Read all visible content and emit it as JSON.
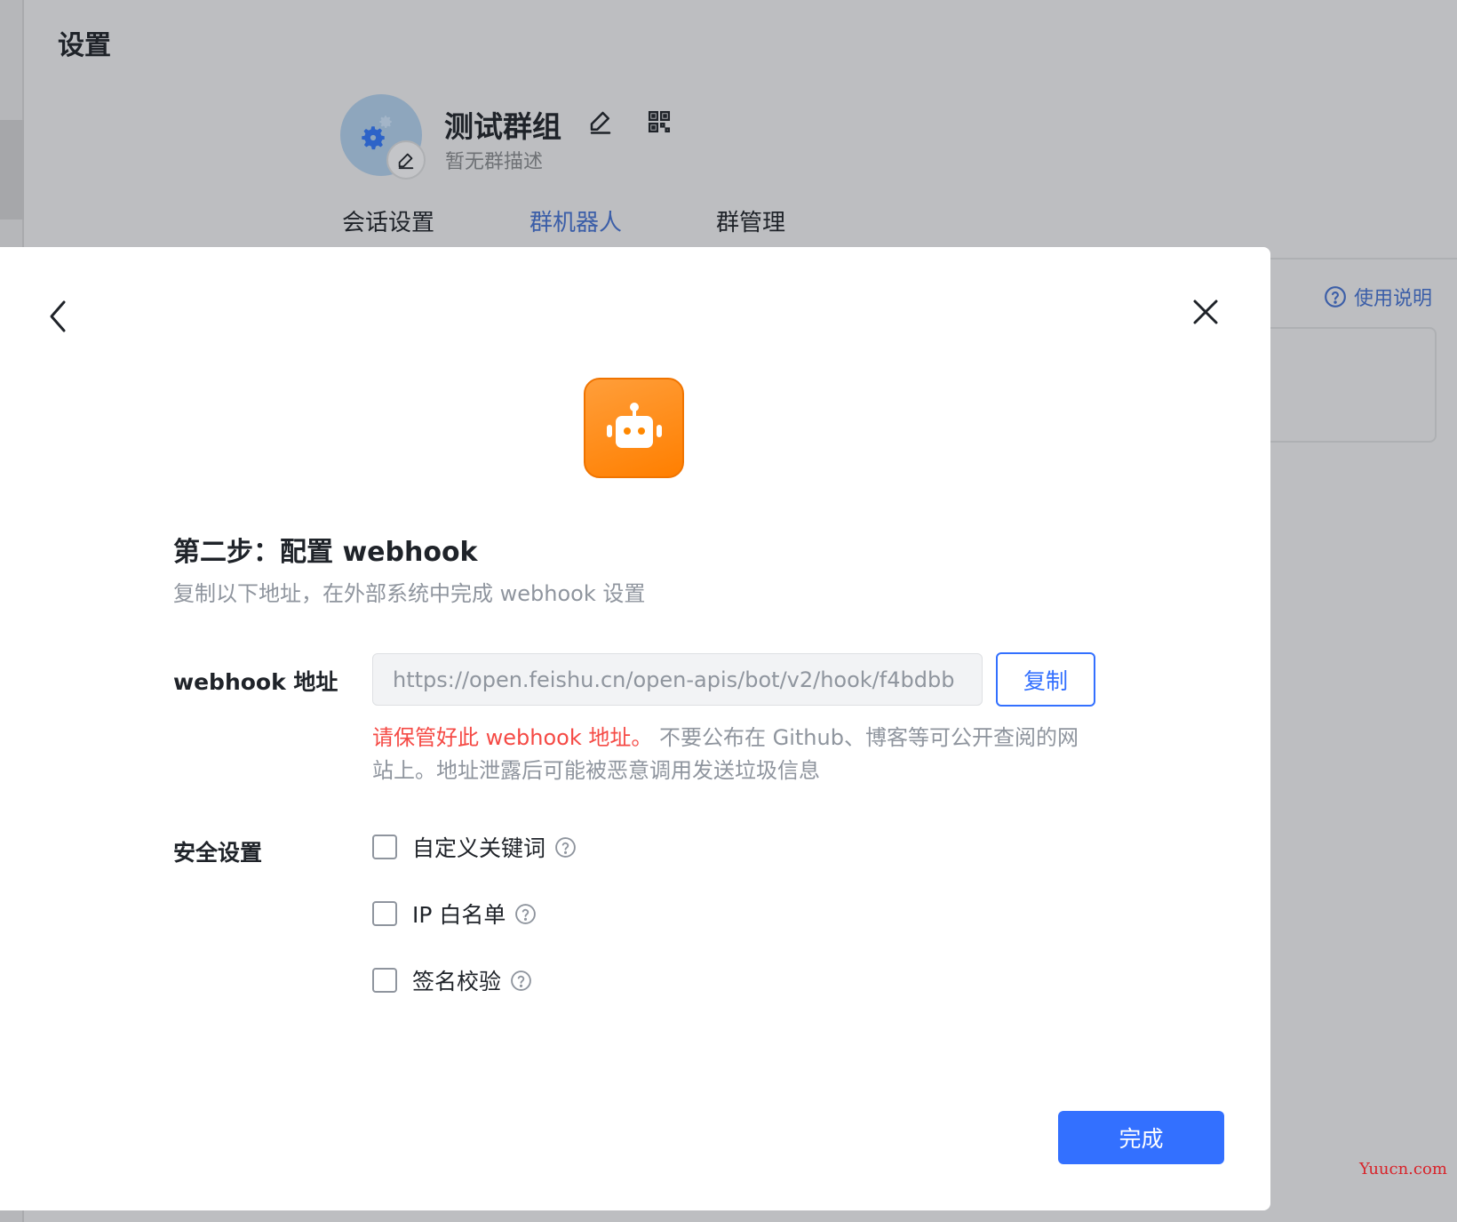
{
  "background": {
    "title": "设置",
    "group": {
      "name": "测试群组",
      "description": "暂无群描述"
    },
    "tabs": [
      {
        "label": "会话设置",
        "active": false
      },
      {
        "label": "群机器人",
        "active": true
      },
      {
        "label": "群管理",
        "active": false
      }
    ],
    "help_link": "使用说明"
  },
  "modal": {
    "step_title": "第二步：配置 webhook",
    "step_desc": "复制以下地址，在外部系统中完成 webhook 设置",
    "webhook_label": "webhook 地址",
    "webhook_url": "https://open.feishu.cn/open-apis/bot/v2/hook/f4bdbb",
    "copy_label": "复制",
    "warning_red": "请保管好此 webhook 地址。",
    "warning_text": " 不要公布在 Github、博客等可公开查阅的网站上。地址泄露后可能被恶意调用发送垃圾信息",
    "security_label": "安全设置",
    "options": [
      {
        "label": "自定义关键词",
        "checked": false
      },
      {
        "label": "IP 白名单",
        "checked": false
      },
      {
        "label": "签名校验",
        "checked": false
      }
    ],
    "done_label": "完成"
  },
  "watermark": "Yuucn.com",
  "colors": {
    "primary": "#3370ff",
    "danger": "#f54a45",
    "bot_orange": "#ff8800"
  }
}
